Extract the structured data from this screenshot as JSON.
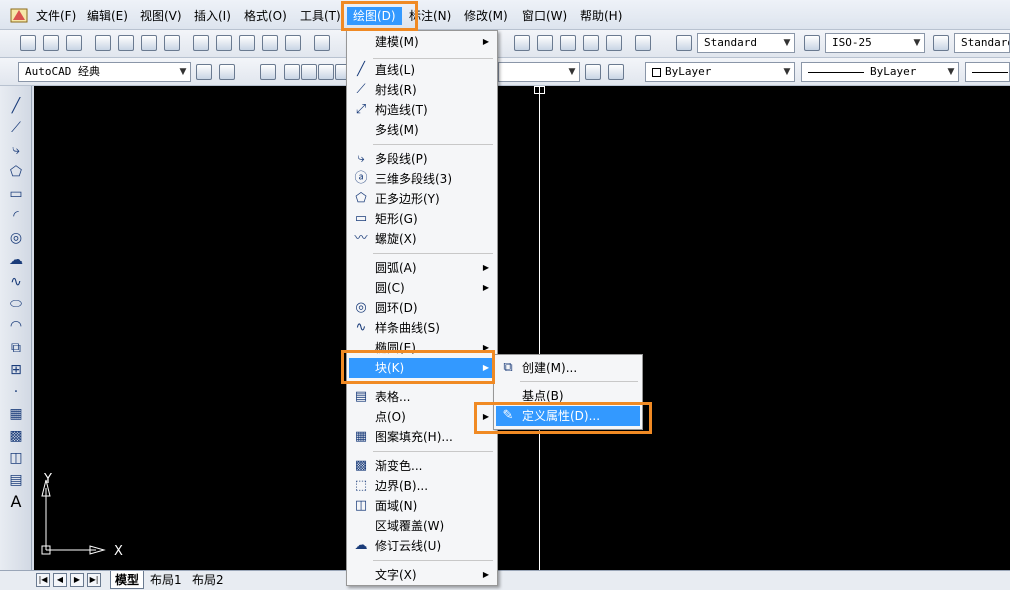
{
  "menubar": {
    "items": [
      "文件(F)",
      "编辑(E)",
      "视图(V)",
      "插入(I)",
      "格式(O)",
      "工具(T)",
      "绘图(D)",
      "标注(N)",
      "修改(M)",
      "窗口(W)",
      "帮助(H)"
    ],
    "active_index": 6
  },
  "toolbar": {
    "text_style": "Standard",
    "dim_style": "ISO-25",
    "table_style": "Standard",
    "workspace": "AutoCAD 经典",
    "color": "ByLayer",
    "linetype": "ByLayer"
  },
  "draw_menu": {
    "items": [
      {
        "label": "建模(M)",
        "icon": "none",
        "submenu": true
      },
      {
        "label": "直线(L)",
        "icon": "line-icon",
        "submenu": false
      },
      {
        "label": "射线(R)",
        "icon": "ray-icon",
        "submenu": false
      },
      {
        "label": "构造线(T)",
        "icon": "construction-line-icon",
        "submenu": false
      },
      {
        "label": "多线(M)",
        "icon": "none",
        "submenu": false
      },
      {
        "label": "多段线(P)",
        "icon": "polyline-icon",
        "submenu": false
      },
      {
        "label": "三维多段线(3)",
        "icon": "3d-polyline-icon",
        "submenu": false
      },
      {
        "label": "正多边形(Y)",
        "icon": "polygon-icon",
        "submenu": false
      },
      {
        "label": "矩形(G)",
        "icon": "rectangle-icon",
        "submenu": false
      },
      {
        "label": "螺旋(X)",
        "icon": "helix-icon",
        "submenu": false
      },
      {
        "label": "圆弧(A)",
        "icon": "none",
        "submenu": true
      },
      {
        "label": "圆(C)",
        "icon": "none",
        "submenu": true
      },
      {
        "label": "圆环(D)",
        "icon": "donut-icon",
        "submenu": false
      },
      {
        "label": "样条曲线(S)",
        "icon": "spline-icon",
        "submenu": false
      },
      {
        "label": "椭圆(E)",
        "icon": "none",
        "submenu": true
      },
      {
        "label": "块(K)",
        "icon": "none",
        "submenu": true
      },
      {
        "label": "表格...",
        "icon": "table-icon",
        "submenu": false
      },
      {
        "label": "点(O)",
        "icon": "none",
        "submenu": true
      },
      {
        "label": "图案填充(H)...",
        "icon": "hatch-icon",
        "submenu": false
      },
      {
        "label": "渐变色...",
        "icon": "gradient-icon",
        "submenu": false
      },
      {
        "label": "边界(B)...",
        "icon": "boundary-icon",
        "submenu": false
      },
      {
        "label": "面域(N)",
        "icon": "region-icon",
        "submenu": false
      },
      {
        "label": "区域覆盖(W)",
        "icon": "none",
        "submenu": false
      },
      {
        "label": "修订云线(U)",
        "icon": "revcloud-icon",
        "submenu": false
      },
      {
        "label": "文字(X)",
        "icon": "none",
        "submenu": true
      }
    ],
    "selected_index": 15
  },
  "block_submenu": {
    "items": [
      {
        "label": "创建(M)...",
        "icon": "block-create-icon"
      },
      {
        "label": "基点(B)",
        "icon": "none"
      },
      {
        "label": "定义属性(D)...",
        "icon": "define-attribute-icon"
      }
    ],
    "selected_index": 2
  },
  "ucs": {
    "x_label": "X",
    "y_label": "Y"
  },
  "tabs": [
    "模型",
    "布局1",
    "布局2"
  ],
  "colors": {
    "highlight": "#f08a24",
    "selection": "#3399ff",
    "canvas": "#000000"
  }
}
